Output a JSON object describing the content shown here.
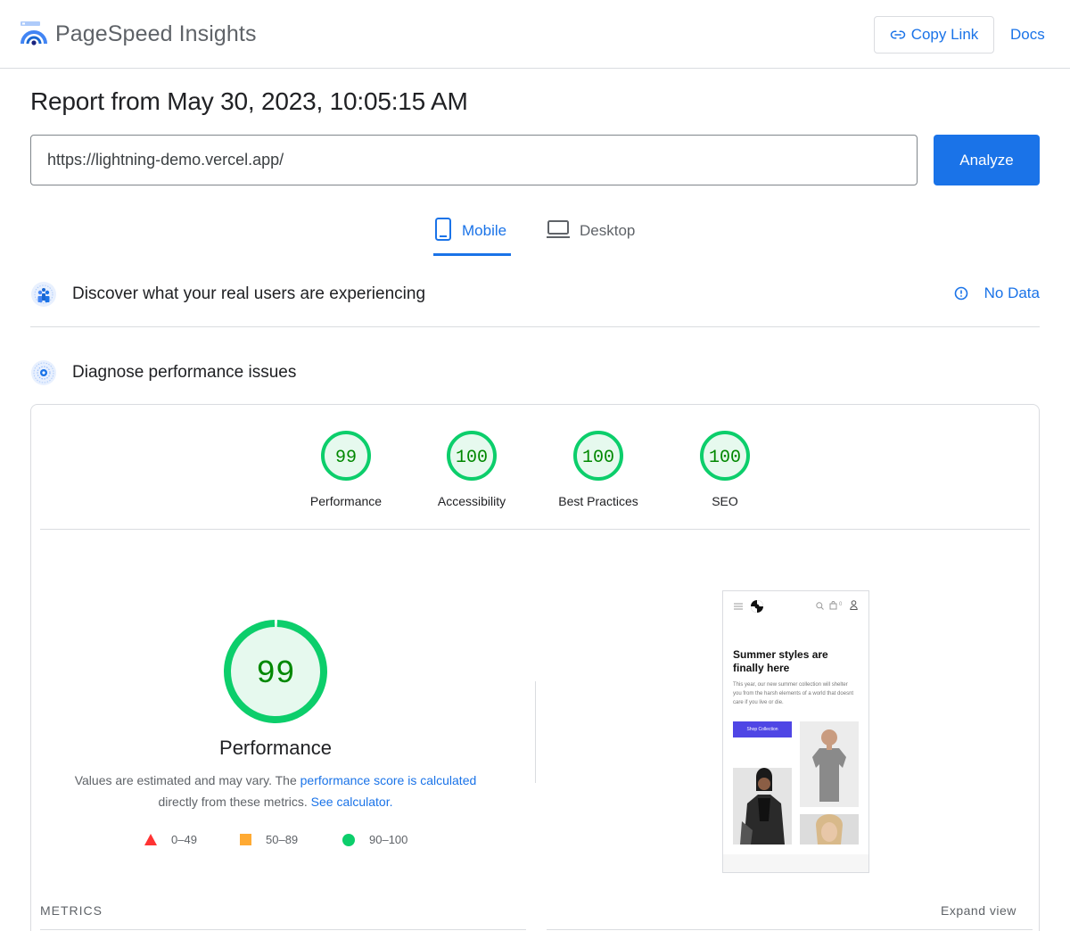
{
  "app": {
    "name": "PageSpeed Insights",
    "copy_link": "Copy Link",
    "docs": "Docs"
  },
  "report": {
    "title": "Report from May 30, 2023, 10:05:15 AM",
    "url": "https://lightning-demo.vercel.app/",
    "analyze": "Analyze"
  },
  "tabs": [
    {
      "label": "Mobile",
      "active": true
    },
    {
      "label": "Desktop",
      "active": false
    }
  ],
  "sections": {
    "real_users": "Discover what your real users are experiencing",
    "no_data": "No Data",
    "diagnose": "Diagnose performance issues"
  },
  "scores": [
    {
      "value": "99",
      "label": "Performance",
      "fraction": 0.99
    },
    {
      "value": "100",
      "label": "Accessibility",
      "fraction": 1.0
    },
    {
      "value": "100",
      "label": "Best Practices",
      "fraction": 1.0
    },
    {
      "value": "100",
      "label": "SEO",
      "fraction": 1.0
    }
  ],
  "performance": {
    "score": "99",
    "fraction": 0.99,
    "title": "Performance",
    "desc_prefix": "Values are estimated and may vary. The ",
    "desc_link": "performance score is calculated",
    "desc_mid": "directly from these metrics. ",
    "desc_link2": "See calculator."
  },
  "legend": [
    {
      "range": "0–49",
      "shape": "triangle",
      "color": "#ff3333"
    },
    {
      "range": "50–89",
      "shape": "square",
      "color": "#ffaa33"
    },
    {
      "range": "90–100",
      "shape": "circle",
      "color": "#0cce6b"
    }
  ],
  "metrics": {
    "label": "METRICS",
    "expand": "Expand view"
  },
  "thumbnail": {
    "headline": "Summer styles are finally here",
    "copy": "This year, our new summer collection will shelter you from the harsh elements of a world that doesnt care if you live or die.",
    "button": "Shop Collection",
    "cart_count": "0"
  },
  "colors": {
    "accent": "#1a73e8",
    "pass": "#0cce6b",
    "pass_text": "#008800",
    "pass_fill": "#e6f9ee"
  }
}
